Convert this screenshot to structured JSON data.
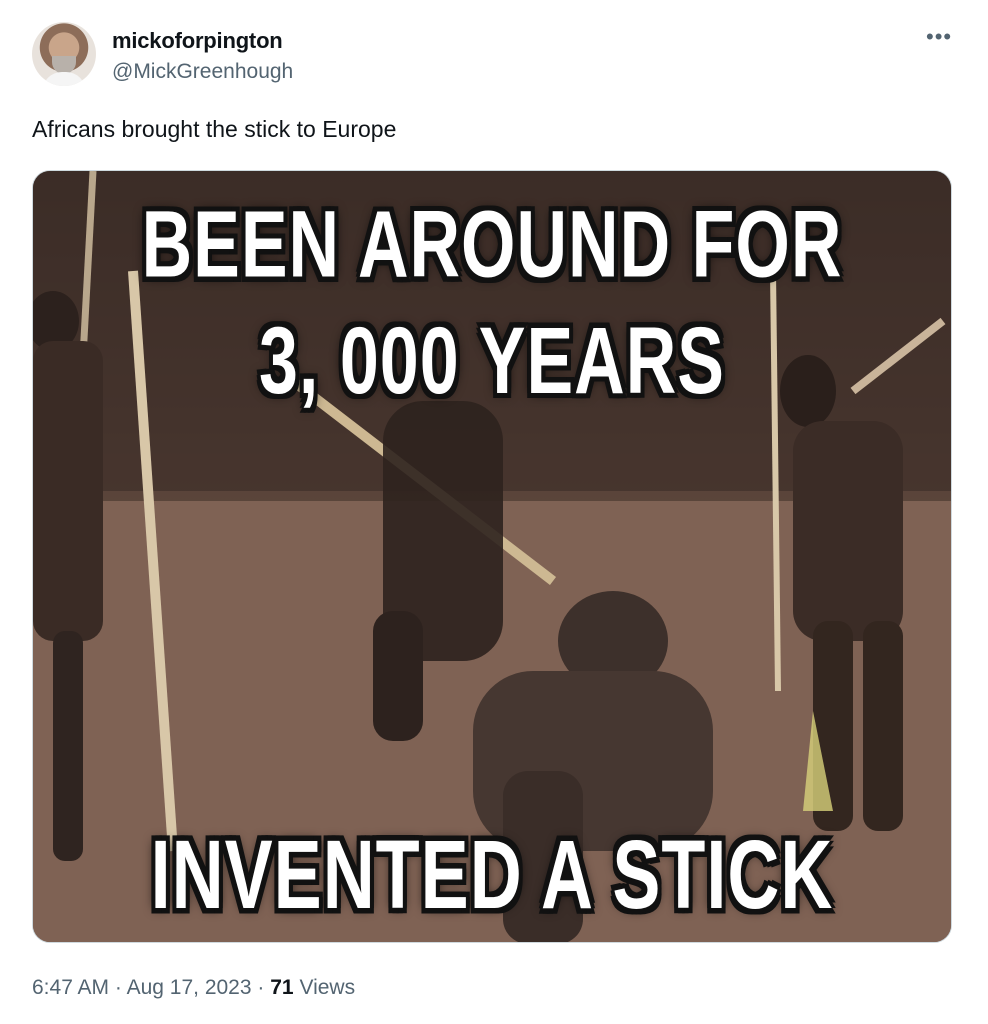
{
  "tweet": {
    "display_name": "mickoforpington",
    "handle": "@MickGreenhough",
    "more_icon": "more-icon",
    "text": "Africans brought the stick to Europe",
    "media": {
      "top_line_1": "BEEN AROUND FOR",
      "top_line_2": "3, 000 YEARS",
      "bottom_line": "INVENTED A STICK"
    },
    "time": "6:47 AM",
    "separator": "·",
    "date": "Aug 17, 2023",
    "views_count": "71",
    "views_label": "Views"
  }
}
